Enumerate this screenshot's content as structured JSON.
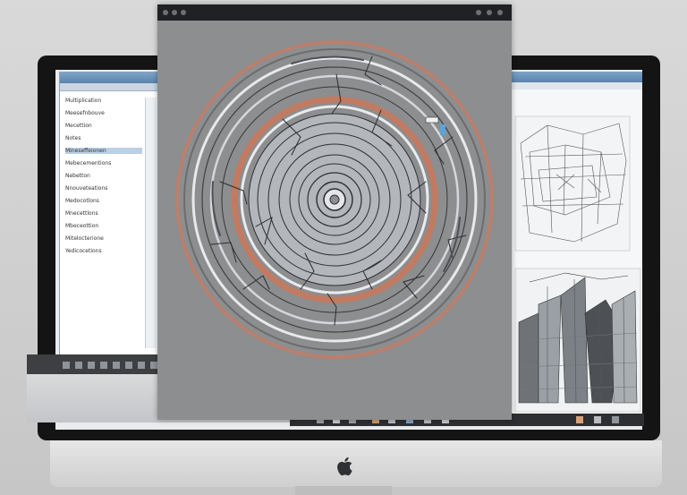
{
  "center_window": {
    "title": "",
    "icons": [
      "circular-drawing-icon"
    ]
  },
  "left_window": {
    "items": [
      "Multiplication",
      "Meesefnbouve",
      "Mecettion",
      "Notes",
      "Mineseffeionen",
      "Mebecementions",
      "Nebetton",
      "Nnouveteations",
      "Medocotlons",
      "Mnecettlons",
      "Mbeceottion",
      "Mitelocterione",
      "Yedicocetions"
    ],
    "selected_index": 4
  },
  "right_window": {
    "panels": [
      "architectural-sketch",
      "cityscape-sketch"
    ]
  },
  "taskbar": {
    "icons": [
      "finder-icon",
      "app-icon",
      "app-icon",
      "app-icon",
      "app-icon",
      "app-icon",
      "app-icon",
      "app-icon"
    ]
  },
  "colors": {
    "bezel": "#141414",
    "accent": "#b9806f",
    "window_bg": "#8c8e90",
    "titlebar": "#1f2124"
  },
  "device": {
    "logo": "apple-logo-icon"
  }
}
